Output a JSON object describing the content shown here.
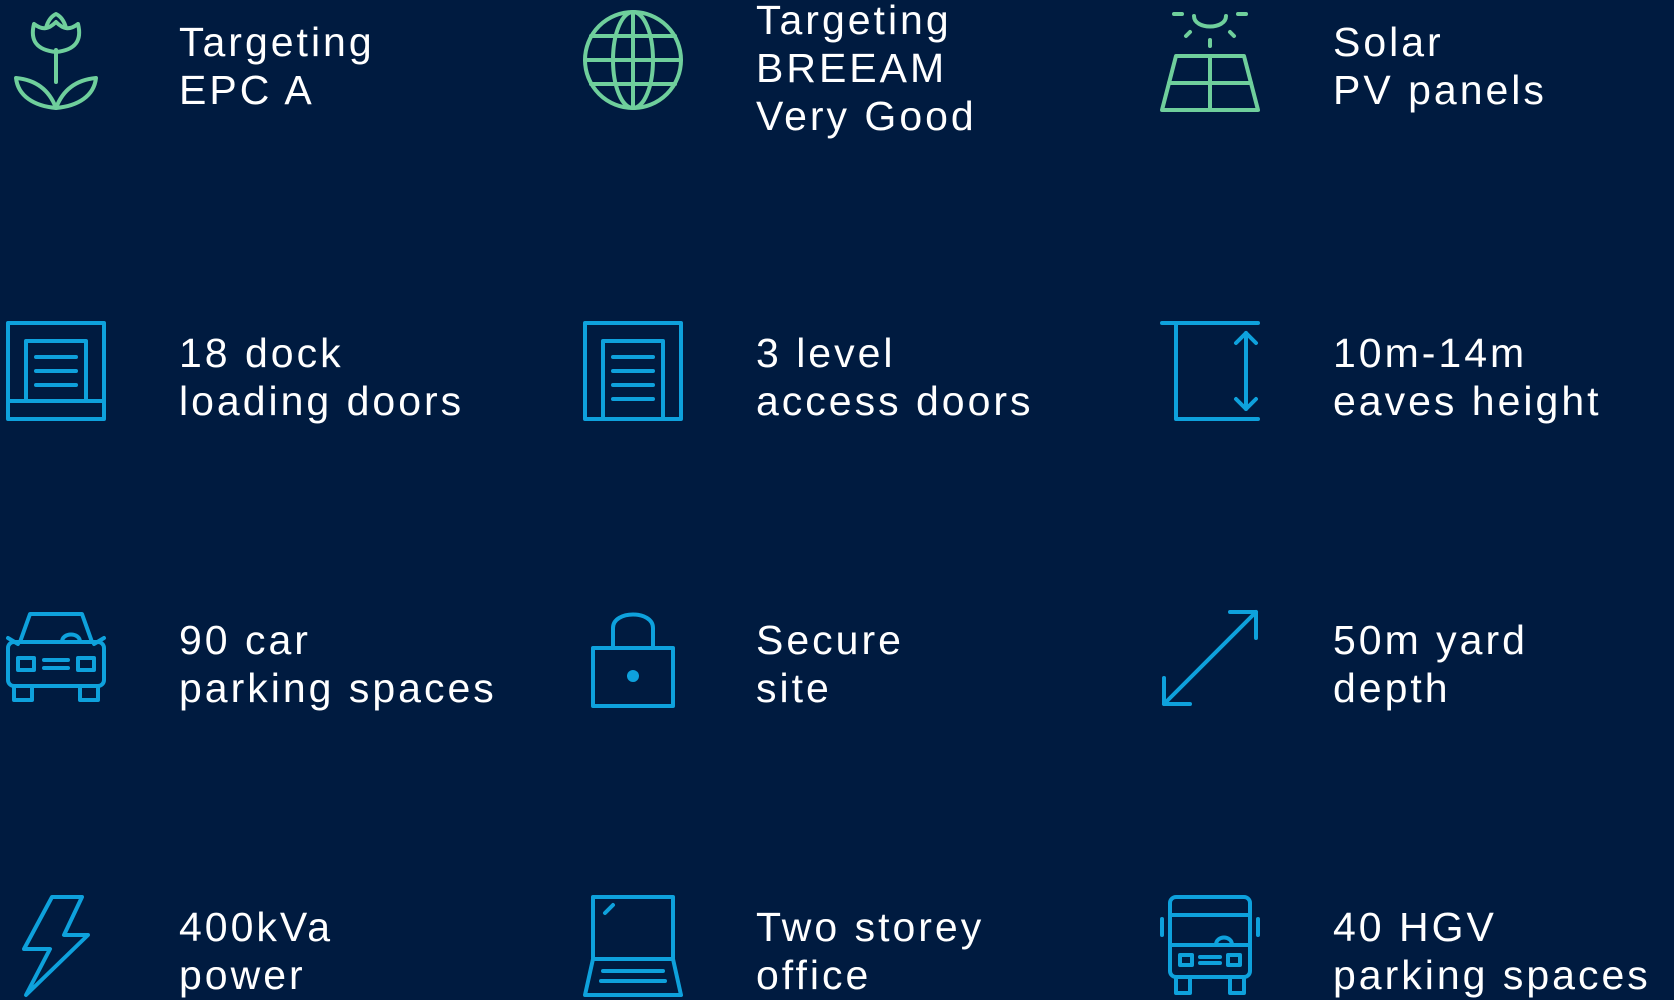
{
  "colors": {
    "background": "#001b40",
    "text": "#ffffff",
    "icon_green": "#6fcf9c",
    "icon_blue": "#0ea1dc"
  },
  "features": [
    {
      "icon": "flower-icon",
      "lines": [
        "Targeting",
        "EPC A"
      ]
    },
    {
      "icon": "globe-icon",
      "lines": [
        "Targeting",
        "BREEAM",
        "Very Good"
      ]
    },
    {
      "icon": "solar-panel-icon",
      "lines": [
        "Solar",
        "PV panels"
      ]
    },
    {
      "icon": "loading-door-icon",
      "lines": [
        "18 dock",
        "loading doors"
      ]
    },
    {
      "icon": "access-door-icon",
      "lines": [
        "3 level",
        "access doors"
      ]
    },
    {
      "icon": "height-arrow-icon",
      "lines": [
        "10m-14m",
        "eaves height"
      ]
    },
    {
      "icon": "car-icon",
      "lines": [
        "90 car",
        "parking spaces"
      ]
    },
    {
      "icon": "padlock-icon",
      "lines": [
        "Secure",
        "site"
      ]
    },
    {
      "icon": "diagonal-arrow-icon",
      "lines": [
        "50m yard",
        "depth"
      ]
    },
    {
      "icon": "lightning-icon",
      "lines": [
        "400kVa",
        "power"
      ]
    },
    {
      "icon": "laptop-icon",
      "lines": [
        "Two storey",
        "office"
      ]
    },
    {
      "icon": "truck-icon",
      "lines": [
        "40 HGV",
        "parking spaces"
      ]
    }
  ]
}
